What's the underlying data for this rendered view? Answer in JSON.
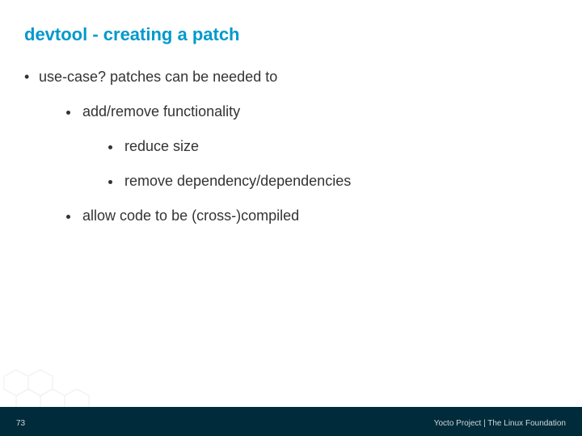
{
  "title": "devtool - creating a patch",
  "bullets": {
    "lvl1_0": "use-case? patches can be needed to",
    "lvl2_0": "add/remove functionality",
    "lvl3_0": "reduce size",
    "lvl3_1": "remove dependency/dependencies",
    "lvl2_1": "allow code to be (cross-)compiled"
  },
  "footer": {
    "page": "73",
    "text": "Yocto Project | The Linux Foundation"
  },
  "colors": {
    "title": "#0099cc",
    "footer_bg": "#002b3a"
  }
}
